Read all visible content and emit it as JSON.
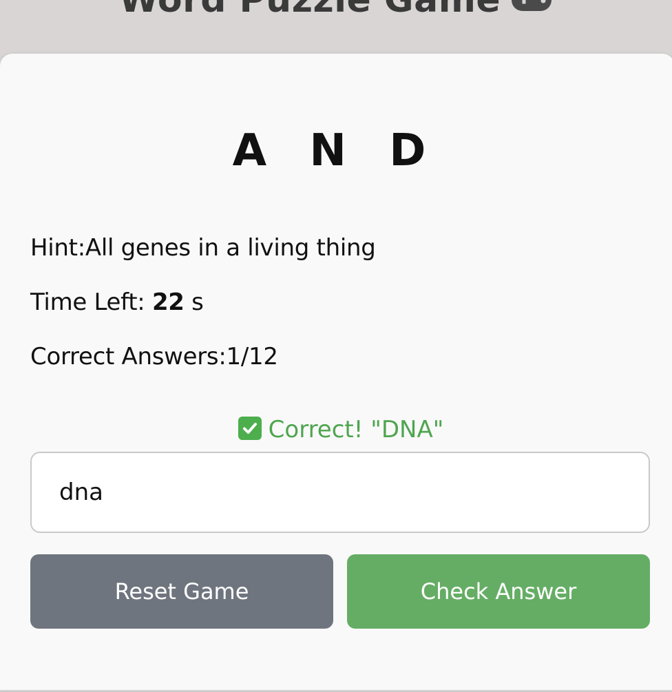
{
  "header": {
    "title": "Word Puzzle Game",
    "title_icon": "gamepad-icon"
  },
  "game": {
    "scrambled_word": "A N D",
    "hint_label": "Hint:",
    "hint_text": "All genes in a living thing",
    "time_label": "Time Left: ",
    "time_value": "22",
    "time_unit": " s",
    "correct_label": "Correct Answers:",
    "correct_count": "1/12",
    "feedback_text": "Correct! \"DNA\"",
    "feedback_icon": "check-mark-icon"
  },
  "answer_input": {
    "value": "dna"
  },
  "buttons": {
    "reset_label": "Reset Game",
    "check_label": "Check Answer"
  },
  "colors": {
    "success": "#4fa54f",
    "reset_button": "#6f757e",
    "check_button": "#65ad65",
    "header_bg": "#d8d5d4"
  }
}
